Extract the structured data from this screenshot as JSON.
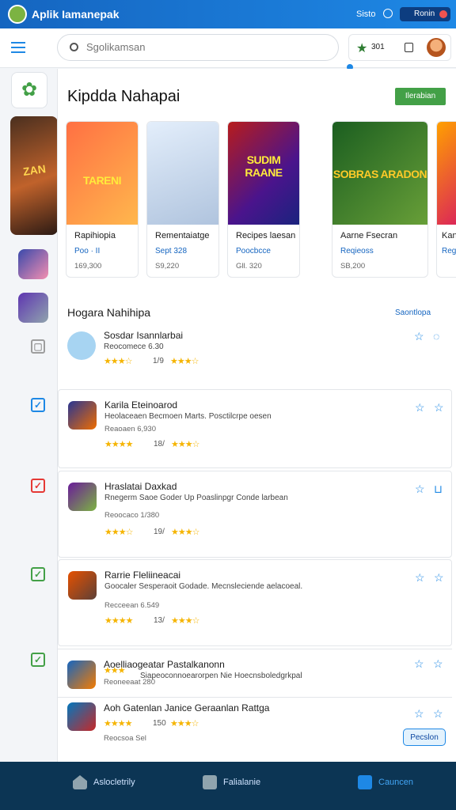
{
  "app": {
    "title": "Aplik Iamanepak",
    "status_text": "Sisto",
    "pill_label": "Ronin",
    "avatar": "android-avatar"
  },
  "search": {
    "placeholder": "Sgolikamsan",
    "icon": "search-icon"
  },
  "header": {
    "count": "301",
    "icons": [
      "star-icon",
      "clipboard-icon",
      "user-face-icon"
    ]
  },
  "featured": {
    "title": "Kipdda Nahapai",
    "button": "Ilerabian",
    "feature_banner": "ZAN",
    "cards": [
      {
        "name": "Rapihiopia",
        "sub": "Poo · II",
        "price": "169,300",
        "art": "TARENI",
        "bg": "#ff8a30"
      },
      {
        "name": "Rementaiatge",
        "sub": "Sept 328",
        "price": "S9,220",
        "art": "",
        "bg": "#c9d8ea"
      },
      {
        "name": "Recipes laesan",
        "sub": "Poocbcce",
        "price": "Gll. 320",
        "art": "SUDIM RAANE",
        "bg": "#6a1b9a"
      },
      {
        "name": "Aarne Fsecran",
        "sub": "Reqieoss",
        "price": "SB,200",
        "art": "SOBRAS ARADON",
        "bg": "#33691e"
      },
      {
        "name": "Kan",
        "sub": "Reg",
        "price": "",
        "art": "",
        "bg": "#ffb300"
      }
    ]
  },
  "list": {
    "title": "Hogara Nahihipa",
    "see_all": "Saontlopa",
    "rows": [
      {
        "title": "Sosdar Isannlarbai",
        "desc": "Reocomece 6.30",
        "meta": "",
        "stars": "★★★☆",
        "rating": "1/9",
        "stars2": "★★★☆"
      },
      {
        "title": "Karila Eteinoarod",
        "desc": "Heolaceaen Becmoen Marts. Posctilcrpe oesen",
        "meta": "Reaoaen 6,930",
        "stars": "★★★★",
        "rating": "18/",
        "stars2": "★★★☆"
      },
      {
        "title": "Hraslatai Daxkad",
        "desc": "Rnegerm Saoe Goder Up Poaslinpgr Conde larbean",
        "meta": "Reoocaco 1/380",
        "stars": "★★★☆",
        "rating": "19/",
        "stars2": "★★★☆"
      },
      {
        "title": "Rarrie Fleliineacai",
        "desc": "Goocaler Sesperaoit Godade. Mecnsleciende aelacoeal.",
        "meta": "Recceean 6.549",
        "stars": "★★★★",
        "rating": "13/",
        "stars2": "★★★☆"
      },
      {
        "title": "Aoelliaogeatar Pastalkanonn",
        "desc": "Siapeoconnoearorpen Nie Hoecnsboledgrkpal",
        "meta": "Reoneeaat 280",
        "stars": "★★★",
        "rating": "",
        "stars2": ""
      },
      {
        "title": "Aoh Gatenlan Janice Geraanlan Rattga",
        "desc": "",
        "meta": "Reocsoa Sel",
        "stars": "★★★★",
        "rating": "150",
        "stars2": "★★★☆"
      }
    ],
    "open_button": "Pecslon"
  },
  "nav": {
    "tabs": [
      {
        "label": "Aslocletrily",
        "icon": "home-icon"
      },
      {
        "label": "Falialanie",
        "icon": "library-icon"
      },
      {
        "label": "Cauncen",
        "icon": "store-icon"
      }
    ]
  },
  "colors": {
    "accent": "#1e88e5",
    "brand": "#1565c0",
    "nav_bg": "#0c3554",
    "green": "#43a047",
    "star": "#f5b400"
  }
}
